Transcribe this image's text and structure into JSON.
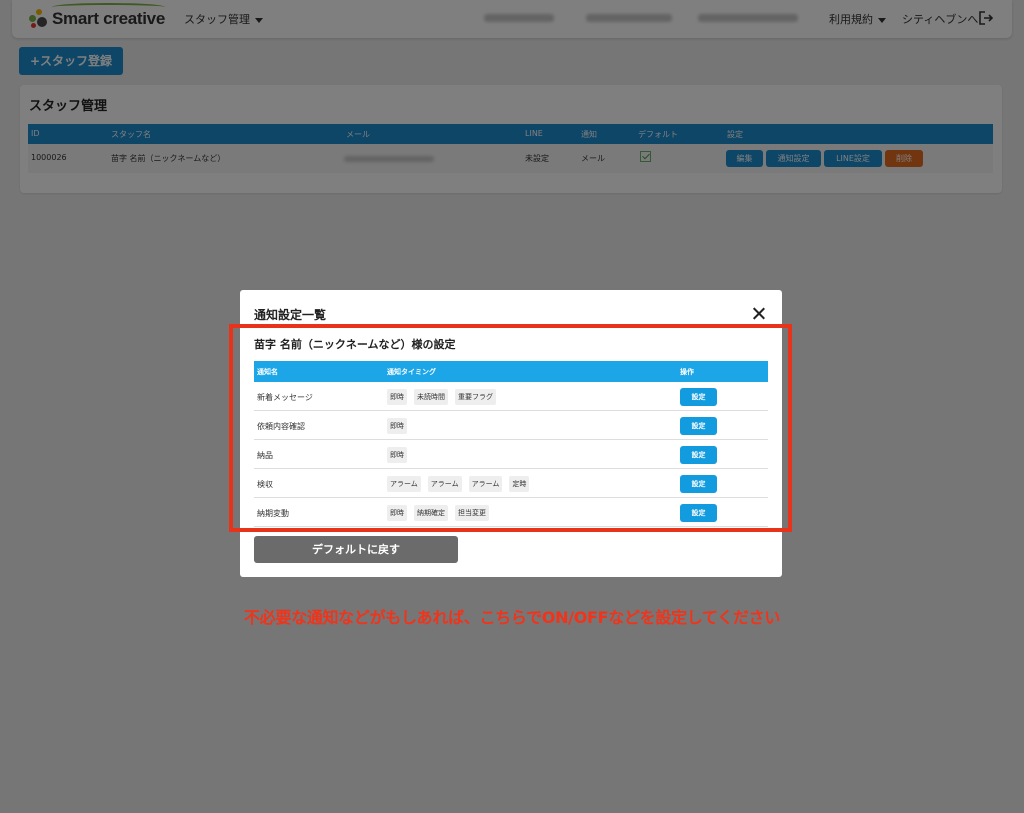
{
  "colors": {
    "primary": "#1d8ccf",
    "table_header": "#1ca6e8",
    "delete": "#e36a1e",
    "annotation_red": "#e8321a",
    "default_button": "#6b6b6b"
  },
  "nav": {
    "logo": "Smart creative",
    "staff_menu": "スタッフ管理",
    "terms_menu": "利用規約",
    "cityheaven_link": "シティヘブンへ",
    "logout_icon": "logout-icon"
  },
  "register_button": "+スタッフ登録",
  "staff_panel": {
    "title": "スタッフ管理",
    "headers": [
      "ID",
      "スタッフ名",
      "メール",
      "LINE",
      "通知",
      "デフォルト",
      "設定"
    ],
    "row": {
      "id": "1000026",
      "name": "苗字 名前（ニックネームなど）",
      "line": "未設定",
      "notify": "メール",
      "default_checked": true
    },
    "buttons": {
      "edit": "編集",
      "notify_settings": "通知設定",
      "line_settings": "LINE設定",
      "delete": "削除"
    }
  },
  "modal": {
    "title": "通知設定一覧",
    "subtitle": "苗字 名前（ニックネームなど）様の設定",
    "headers": {
      "name": "通知名",
      "timing": "通知タイミング",
      "action": "操作"
    },
    "set_label": "設定",
    "rows": [
      {
        "name": "新着メッセージ",
        "tags": [
          "即時",
          "未読時間",
          "重要フラグ"
        ]
      },
      {
        "name": "依頼内容確認",
        "tags": [
          "即時"
        ]
      },
      {
        "name": "納品",
        "tags": [
          "即時"
        ]
      },
      {
        "name": "検収",
        "tags": [
          "アラーム",
          "アラーム",
          "アラーム",
          "定時"
        ]
      },
      {
        "name": "納期変動",
        "tags": [
          "即時",
          "納期確定",
          "担当変更"
        ]
      }
    ],
    "default_button": "デフォルトに戻す"
  },
  "annotation": "不必要な通知などがもしあれば、こちらでON/OFFなどを設定してください"
}
